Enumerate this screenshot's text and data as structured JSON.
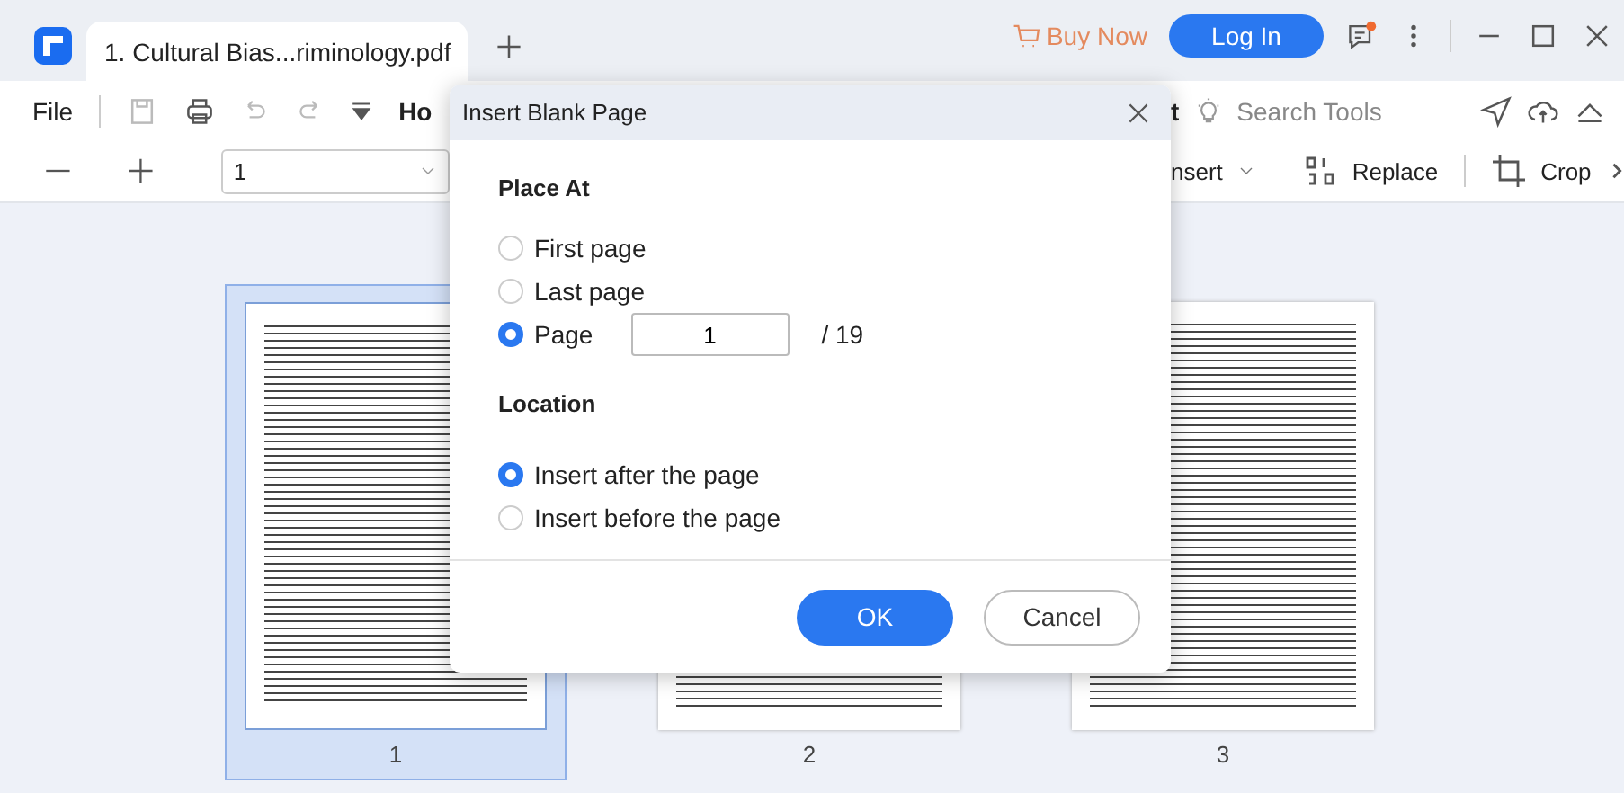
{
  "title_bar": {
    "tab_title": "1. Cultural Bias...riminology.pdf",
    "buy_now": "Buy Now",
    "login": "Log In"
  },
  "toolbar": {
    "file": "File",
    "home_tab": "Ho",
    "tab_after_dialog": "t",
    "search_placeholder": "Search Tools"
  },
  "edit_bar": {
    "page_select": "1",
    "insert": "nsert",
    "replace": "Replace",
    "crop": "Crop"
  },
  "thumbnails": [
    {
      "label": "1",
      "selected": true
    },
    {
      "label": "2",
      "selected": false
    },
    {
      "label": "3",
      "selected": false
    }
  ],
  "dialog": {
    "title": "Insert Blank Page",
    "place_at": {
      "heading": "Place At",
      "options": [
        {
          "kind": "plain",
          "label": "First page",
          "selected": false
        },
        {
          "kind": "plain",
          "label": "Last page",
          "selected": false
        },
        {
          "kind": "page_input",
          "label": "Page",
          "selected": true,
          "value": "1",
          "total": "/ 19"
        }
      ]
    },
    "location": {
      "heading": "Location",
      "options": [
        {
          "kind": "plain",
          "label": "Insert after the page",
          "selected": true
        },
        {
          "kind": "plain",
          "label": "Insert before the page",
          "selected": false
        }
      ]
    },
    "buttons": [
      {
        "kind": "primary",
        "label": "OK"
      },
      {
        "kind": "secondary",
        "label": "Cancel"
      }
    ]
  }
}
